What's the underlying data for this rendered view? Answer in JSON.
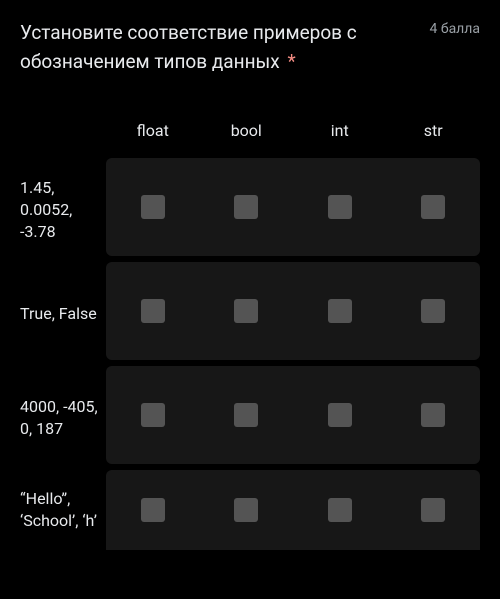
{
  "question": {
    "text": "Установите соответствие примеров с обозначением типов данных",
    "required_marker": "*",
    "points": "4 балла"
  },
  "columns": [
    "float",
    "bool",
    "int",
    "str"
  ],
  "rows": [
    {
      "label": "1.45, 0.0052, -3.78"
    },
    {
      "label": "True, False"
    },
    {
      "label": "4000, -405, 0, 187"
    },
    {
      "label": "“Hello”, ‘School’, ‘h’"
    }
  ]
}
